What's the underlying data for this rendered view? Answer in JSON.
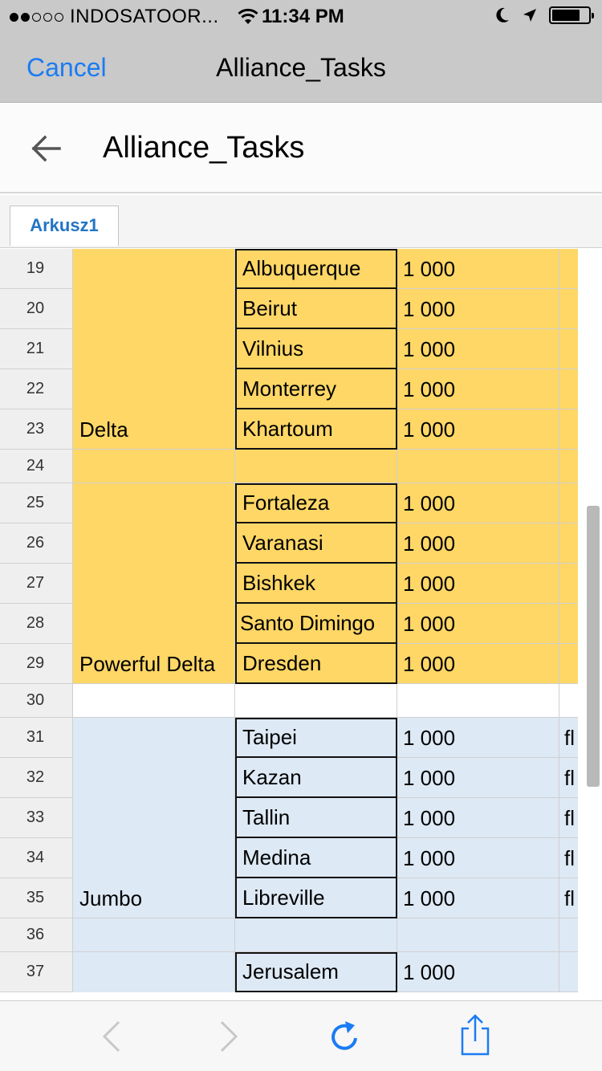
{
  "status": {
    "carrier": "INDOSATOOR...",
    "time": "11:34 PM",
    "signal_dots": [
      true,
      true,
      false,
      false,
      false
    ],
    "battery_level": 0.78
  },
  "nav": {
    "cancel_label": "Cancel",
    "title": "Alliance_Tasks"
  },
  "doc": {
    "title": "Alliance_Tasks"
  },
  "sheet_tabs": [
    "Arkusz1"
  ],
  "colors": {
    "yellow": "#fed766",
    "blue": "#dde9f5",
    "accent": "#1a7cf2",
    "tab_text": "#2275c5"
  },
  "groups": [
    {
      "label": "Delta",
      "label_row": 23,
      "color": "yellow"
    },
    {
      "label": "Powerful Delta",
      "label_row": 29,
      "color": "yellow"
    },
    {
      "label": "Jumbo",
      "label_row": 35,
      "color": "blue"
    }
  ],
  "rows": [
    {
      "num": "19",
      "city": "Albuquerque",
      "value": "1 000",
      "extra": "",
      "color": "yellow"
    },
    {
      "num": "20",
      "city": "Beirut",
      "value": "1 000",
      "extra": "",
      "color": "yellow"
    },
    {
      "num": "21",
      "city": "Vilnius",
      "value": "1 000",
      "extra": "",
      "color": "yellow"
    },
    {
      "num": "22",
      "city": "Monterrey",
      "value": "1 000",
      "extra": "",
      "color": "yellow"
    },
    {
      "num": "23",
      "city": "Khartoum",
      "value": "1 000",
      "extra": "",
      "color": "yellow"
    },
    {
      "num": "24",
      "city": "",
      "value": "",
      "extra": "",
      "color": "yellow"
    },
    {
      "num": "25",
      "city": "Fortaleza",
      "value": "1 000",
      "extra": "",
      "color": "yellow"
    },
    {
      "num": "26",
      "city": "Varanasi",
      "value": "1 000",
      "extra": "",
      "color": "yellow"
    },
    {
      "num": "27",
      "city": "Bishkek",
      "value": "1 000",
      "extra": "",
      "color": "yellow"
    },
    {
      "num": "28",
      "city": "Santo Dimingo",
      "value": "1 000",
      "extra": "",
      "color": "yellow"
    },
    {
      "num": "29",
      "city": "Dresden",
      "value": "1 000",
      "extra": "",
      "color": "yellow"
    },
    {
      "num": "30",
      "city": "",
      "value": "",
      "extra": "",
      "color": "white"
    },
    {
      "num": "31",
      "city": "Taipei",
      "value": "1 000",
      "extra": "fl",
      "color": "blue"
    },
    {
      "num": "32",
      "city": "Kazan",
      "value": "1 000",
      "extra": "fl",
      "color": "blue"
    },
    {
      "num": "33",
      "city": "Tallin",
      "value": "1 000",
      "extra": "fl",
      "color": "blue"
    },
    {
      "num": "34",
      "city": "Medina",
      "value": "1 000",
      "extra": "fl",
      "color": "blue"
    },
    {
      "num": "35",
      "city": "Libreville",
      "value": "1 000",
      "extra": "fl",
      "color": "blue"
    },
    {
      "num": "36",
      "city": "",
      "value": "",
      "extra": "",
      "color": "blue"
    },
    {
      "num": "37",
      "city": "Jerusalem",
      "value": "1 000",
      "extra": "",
      "color": "blue"
    }
  ],
  "toolbar": {
    "icons": [
      "back-icon",
      "forward-icon",
      "reload-icon",
      "share-icon"
    ]
  }
}
